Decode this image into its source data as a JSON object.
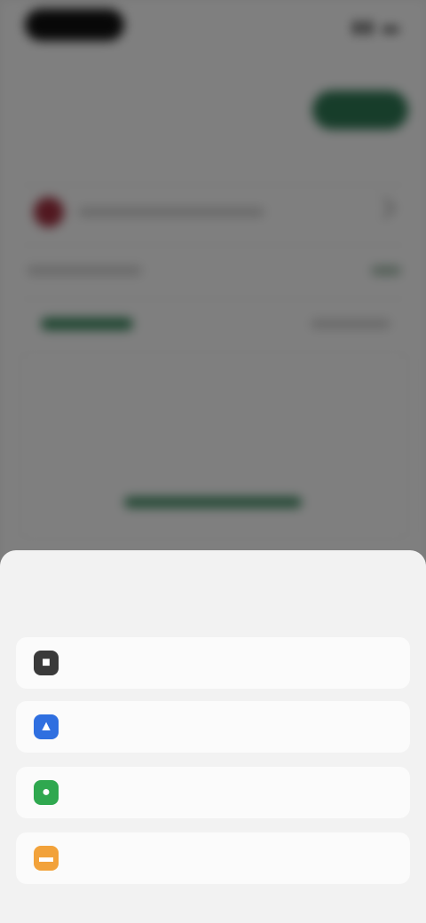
{
  "colors": {
    "accent_green": "#2f7a55",
    "scrim": "rgba(0,0,0,0.5)",
    "sheet_bg": "#f2f2f2",
    "option_icon_colors": [
      "#3a3a3a",
      "#2f6fe0",
      "#2fa84f",
      "#f2a23a"
    ]
  },
  "sheet": {
    "options": [
      {
        "icon": "document-icon"
      },
      {
        "icon": "drive-icon"
      },
      {
        "icon": "image-icon"
      },
      {
        "icon": "folder-icon"
      }
    ]
  }
}
